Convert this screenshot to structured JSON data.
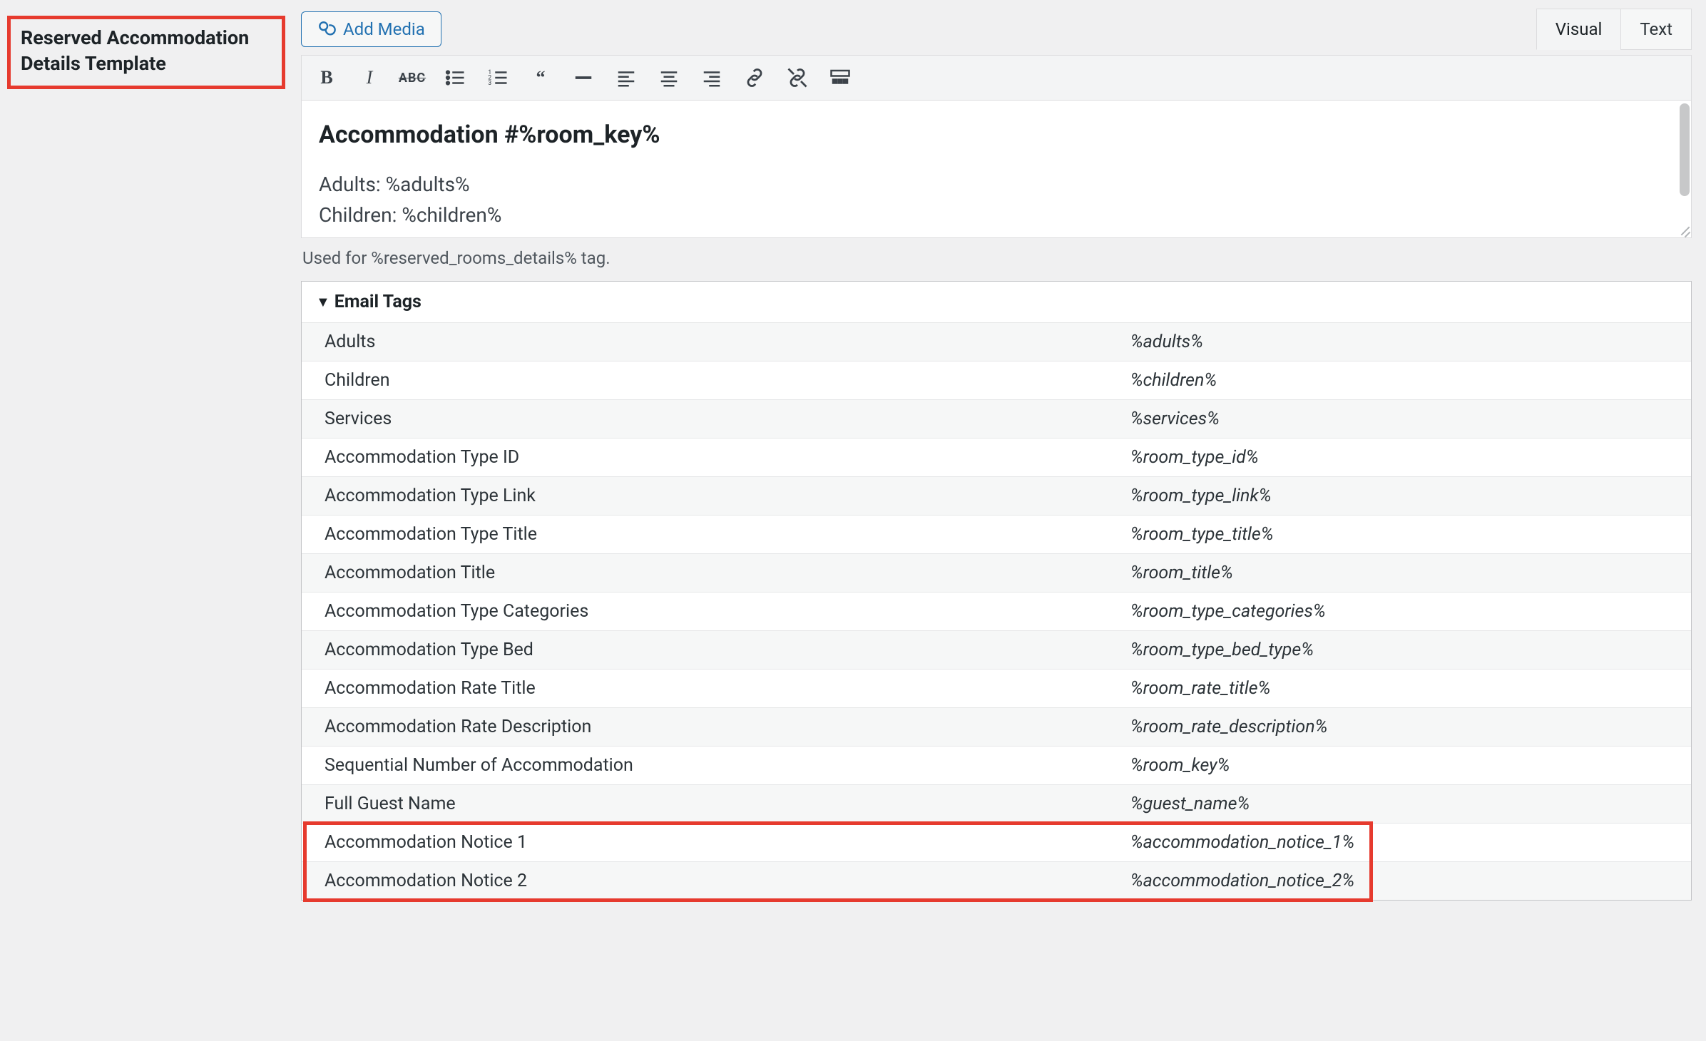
{
  "label": {
    "line1": "Reserved Accommodation",
    "line2": "Details Template"
  },
  "addMediaLabel": "Add Media",
  "tabs": {
    "visual": "Visual",
    "text": "Text"
  },
  "editor": {
    "heading": "Accommodation #%room_key%",
    "line1": "Adults: %adults%",
    "line2": "Children: %children%"
  },
  "hint": "Used for %reserved_rooms_details% tag.",
  "accordion": {
    "title": "Email Tags"
  },
  "tags": [
    {
      "label": "Adults",
      "value": "%adults%"
    },
    {
      "label": "Children",
      "value": "%children%"
    },
    {
      "label": "Services",
      "value": "%services%"
    },
    {
      "label": "Accommodation Type ID",
      "value": "%room_type_id%"
    },
    {
      "label": "Accommodation Type Link",
      "value": "%room_type_link%"
    },
    {
      "label": "Accommodation Type Title",
      "value": "%room_type_title%"
    },
    {
      "label": "Accommodation Title",
      "value": "%room_title%"
    },
    {
      "label": "Accommodation Type Categories",
      "value": "%room_type_categories%"
    },
    {
      "label": "Accommodation Type Bed",
      "value": "%room_type_bed_type%"
    },
    {
      "label": "Accommodation Rate Title",
      "value": "%room_rate_title%"
    },
    {
      "label": "Accommodation Rate Description",
      "value": "%room_rate_description%"
    },
    {
      "label": "Sequential Number of Accommodation",
      "value": "%room_key%"
    },
    {
      "label": "Full Guest Name",
      "value": "%guest_name%"
    },
    {
      "label": "Accommodation Notice 1",
      "value": "%accommodation_notice_1%"
    },
    {
      "label": "Accommodation Notice 2",
      "value": "%accommodation_notice_2%"
    }
  ]
}
